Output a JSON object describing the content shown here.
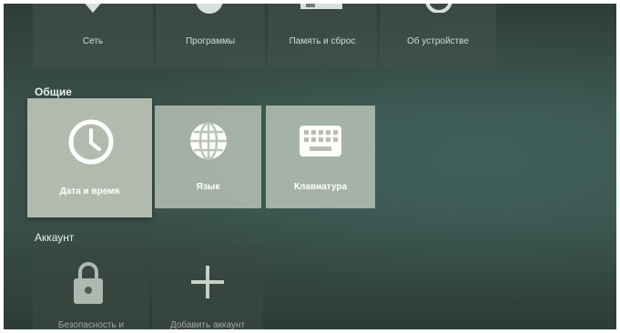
{
  "top_row": [
    {
      "label": "Сеть",
      "icon": "location-pin-icon"
    },
    {
      "label": "Программы",
      "icon": "apps-icon"
    },
    {
      "label": "Память и сброс",
      "icon": "storage-icon"
    },
    {
      "label": "Об устройстве",
      "icon": "info-icon"
    }
  ],
  "general": {
    "title": "Общие",
    "items": [
      {
        "label": "Дата и время",
        "icon": "clock-icon"
      },
      {
        "label": "Язык",
        "icon": "globe-icon"
      },
      {
        "label": "Клавиатура",
        "icon": "keyboard-icon"
      }
    ]
  },
  "account": {
    "title": "Аккаунт",
    "items": [
      {
        "label": "Безопасность и",
        "icon": "lock-icon"
      },
      {
        "label": "Добавить аккаунт",
        "icon": "plus-icon"
      }
    ]
  }
}
